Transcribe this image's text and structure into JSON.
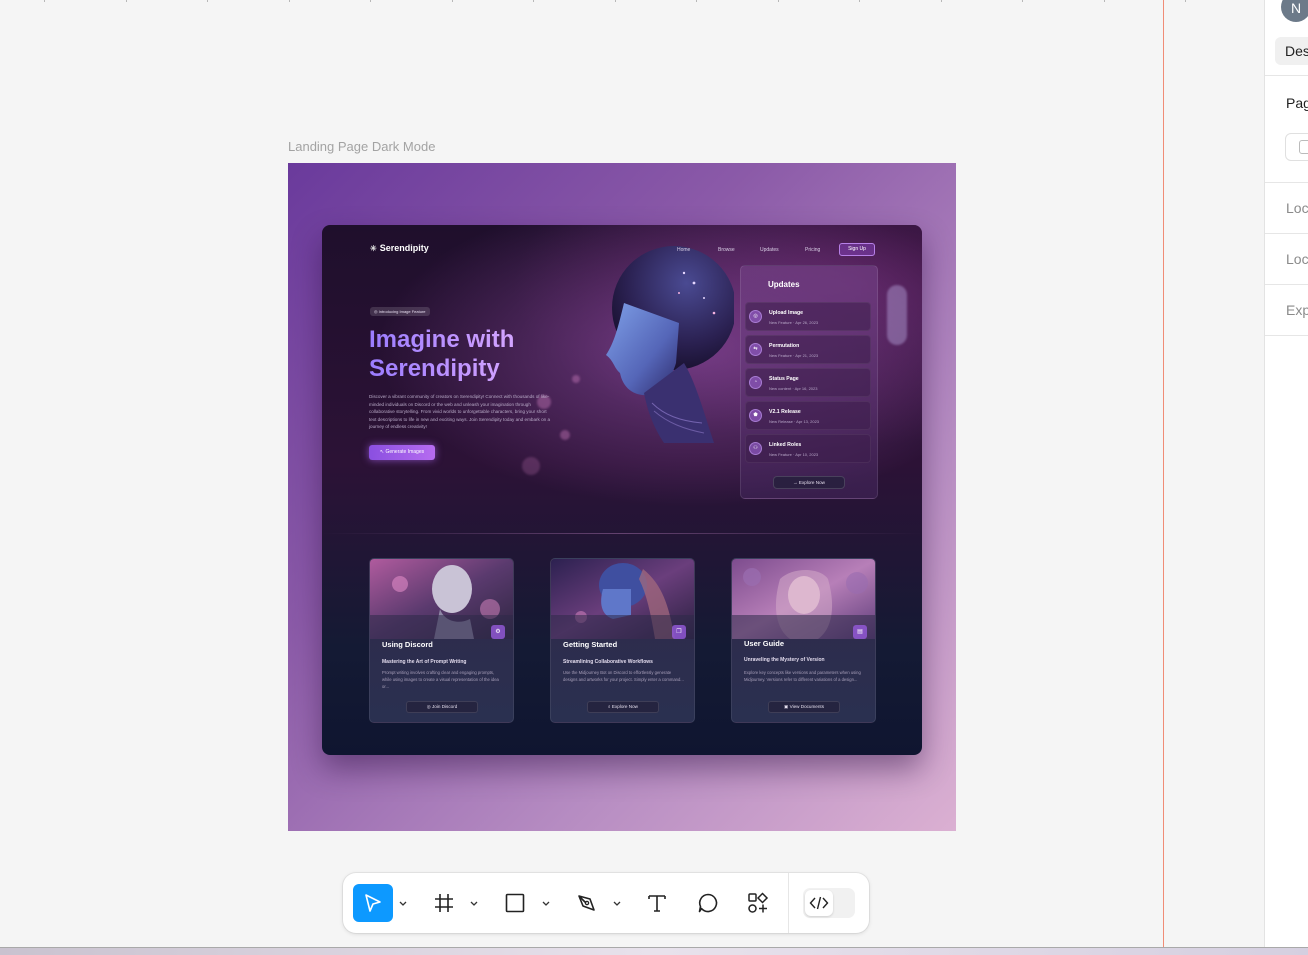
{
  "canvas": {
    "frame_label": "Landing Page Dark Mode"
  },
  "right_panel": {
    "avatar_initial": "N",
    "tab_label": "Des",
    "section_title": "Pag",
    "rows": [
      "Loc",
      "Loc",
      "Exp"
    ]
  },
  "site": {
    "brand": "Serendipity",
    "nav": [
      "Home",
      "Browse",
      "Updates",
      "Pricing"
    ],
    "signup_label": "Sign Up",
    "badge": "Introducing Image Feature",
    "headline_line1": "Imagine with",
    "headline_line2": "Serendipity",
    "description": "Discover a vibrant community of creators on Serendipity! Connect with thousands of like-minded individuals on Discord or the web and unleash your imagination through collaborative storytelling. From vivid worlds to unforgettable characters, bring your short text descriptions to life in new and exciting ways. Join Serendipity today and embark on a journey of endless creativity!",
    "cta_label": "Generate Images",
    "updates": {
      "title": "Updates",
      "items": [
        {
          "title": "Upload Image",
          "meta": "New Feature · Apr 26, 2023"
        },
        {
          "title": "Permutation",
          "meta": "New Feature · Apr 21, 2023"
        },
        {
          "title": "Status Page",
          "meta": "New content · Apr 16, 2023"
        },
        {
          "title": "V2.1 Release",
          "meta": "New Release · Apr 13, 2023"
        },
        {
          "title": "Linked Roles",
          "meta": "New Feature · Apr 10, 2023"
        }
      ],
      "explore_label": "Explore Now"
    },
    "cards": [
      {
        "title": "Using Discord",
        "subtitle": "Mastering the Art of Prompt Writing",
        "desc": "Prompt writing involves crafting clear and engaging prompts, while using images to create a visual representation of the idea or...",
        "button": "Join Discord"
      },
      {
        "title": "Getting Started",
        "subtitle": "Streamlining Collaborative Workflows",
        "desc": "Use the Midjourney Bot on Discord to effortlessly generate designs and artworks for your project. Simply enter a command...",
        "button": "Explore Now"
      },
      {
        "title": "User Guide",
        "subtitle": "Unraveling the Mystery of Version",
        "desc": "Explore key concepts like versions and parameters when using Midjourney. Versions refer to different variations of a design...",
        "button": "View Documents"
      }
    ]
  },
  "toolbar": {
    "tools": [
      "move-tool",
      "frame-tool",
      "shape-tool",
      "pen-tool",
      "text-tool",
      "comment-tool",
      "resources-tool",
      "dev-mode-toggle"
    ],
    "active_tool": "move-tool",
    "active_color": "#0d99ff"
  }
}
